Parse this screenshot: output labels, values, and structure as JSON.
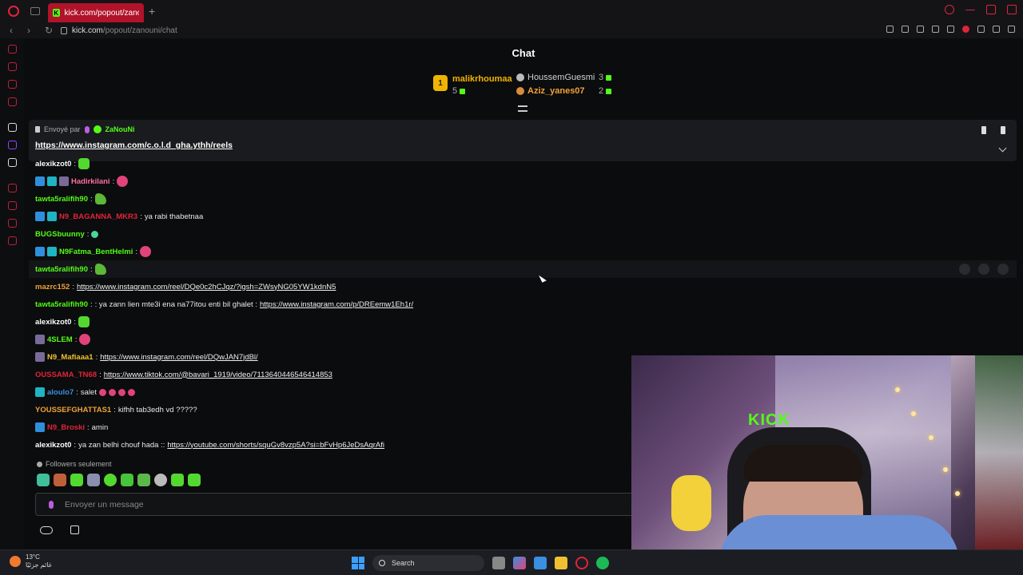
{
  "browser": {
    "tab_title": "kick.com/popout/zanouni",
    "new_tab": "+",
    "url_host": "kick.com",
    "url_path": "/popout/zanouni/chat"
  },
  "chat": {
    "title": "Chat",
    "leaderboard": [
      {
        "rank": "1",
        "name": "malikrhoumaa",
        "count": "5",
        "color": "#f0b400"
      },
      {
        "rank": "2",
        "name": "HoussemGuesmi",
        "count": "3",
        "color": "#cfcfcf"
      },
      {
        "rank": "3",
        "name": "Aziz_yanes07",
        "count": "2",
        "color": "#f0a23a"
      }
    ],
    "pinned": {
      "sent_by_label": "Envoyé par",
      "author": "ZaNouNi",
      "link": "https://www.instagram.com/c.o.l.d_gha.ythh/reels"
    },
    "messages": [
      {
        "user": "alexikzot0",
        "sep": ":",
        "text": "",
        "link": "",
        "color": "#ffffff"
      },
      {
        "user": "Hadirkilani",
        "sep": ":",
        "text": "",
        "link": "",
        "color": "#ff6fa0"
      },
      {
        "user": "tawta5ralifih90",
        "sep": ":",
        "text": "",
        "link": "",
        "color": "#53fc18"
      },
      {
        "user": "N9_BAGANNA_MKR3",
        "sep": ":",
        "text": "ya rabi thabetnaa",
        "link": "",
        "color": "#e0243a"
      },
      {
        "user": "BUGSbuunny",
        "sep": ":",
        "text": "",
        "link": "",
        "color": "#53fc18"
      },
      {
        "user": "N9Fatma_BentHelmi",
        "sep": ":",
        "text": "",
        "link": "",
        "color": "#53fc18"
      },
      {
        "user": "tawta5ralifih90",
        "sep": ":",
        "text": "",
        "link": "",
        "color": "#53fc18"
      },
      {
        "user": "mazrc152",
        "sep": ":",
        "text": "",
        "link": "https://www.instagram.com/reel/DQe0c2hCJqz/?igsh=ZWsyNG05YW1kdnN5",
        "color": "#f0a23a"
      },
      {
        "user": "tawta5ralifih90",
        "sep": ":",
        "text": ": ya zann lien mte3i ena na77itou enti bil ghalet :",
        "link": "https://www.instagram.com/p/DREemw1Eh1r/",
        "color": "#53fc18"
      },
      {
        "user": "alexikzot0",
        "sep": ":",
        "text": "",
        "link": "",
        "color": "#ffffff"
      },
      {
        "user": "4SLEM",
        "sep": ":",
        "text": "",
        "link": "",
        "color": "#53fc18"
      },
      {
        "user": "N9_Mafiaaa1",
        "sep": ":",
        "text": "",
        "link": "https://www.instagram.com/reel/DQwJAN7jdBl/",
        "color": "#f0c030"
      },
      {
        "user": "OUSSAMA_TN68",
        "sep": ":",
        "text": "",
        "link": "https://www.tiktok.com/@bavari_1919/video/7113640446546414853",
        "color": "#e0243a"
      },
      {
        "user": "aloulo7",
        "sep": ":",
        "text": "salet",
        "link": "",
        "color": "#3a8fe0"
      },
      {
        "user": "YOUSSEFGHATTAS1",
        "sep": ":",
        "text": "kifhh tab3edh vd ?????",
        "link": "",
        "color": "#f0a23a"
      },
      {
        "user": "N9_Broski",
        "sep": ":",
        "text": "amin",
        "link": "",
        "color": "#e0243a"
      },
      {
        "user": "alexikzot0",
        "sep": ":",
        "text": "ya zan belhi chouf hada ::",
        "link": "https://youtube.com/shorts/squGv8vzp5A?si=bFvHp6JeDsAqrAfi",
        "color": "#ffffff"
      }
    ],
    "followers_only": "Followers seulement",
    "input_placeholder": "Envoyer un message"
  },
  "webcam": {
    "sign": "KICK"
  },
  "taskbar": {
    "temperature": "13°C",
    "weather_desc": "غائم جزئيًا",
    "search": "Search"
  },
  "colors": {
    "kick_green": "#53fc18",
    "opera_red": "#e0243a",
    "background": "#0b0c0d"
  }
}
